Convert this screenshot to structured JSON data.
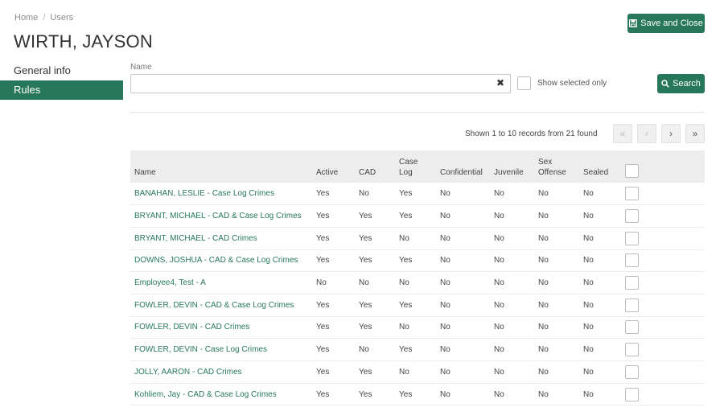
{
  "breadcrumb": {
    "home": "Home",
    "separator": "/",
    "current": "Users"
  },
  "page_title": "WIRTH, JAYSON",
  "actions": {
    "save_close": "Save and Close",
    "search": "Search"
  },
  "sidebar": {
    "items": [
      {
        "label": "General info",
        "active": false
      },
      {
        "label": "Rules",
        "active": true
      }
    ]
  },
  "filter": {
    "name_label": "Name",
    "name_value": "",
    "clear_glyph": "✖",
    "show_selected_label": "Show selected only"
  },
  "pager": {
    "info": "Shown 1 to 10 records from 21 found",
    "first": "«",
    "prev": "‹",
    "next": "›",
    "last": "»"
  },
  "table": {
    "headers": {
      "name": "Name",
      "active": "Active",
      "cad": "CAD",
      "case_log_1": "Case",
      "case_log_2": "Log",
      "confidential": "Confidential",
      "juvenile": "Juvenile",
      "sex_offense_1": "Sex",
      "sex_offense_2": "Offense",
      "sealed": "Sealed"
    },
    "rows": [
      {
        "name": "BANAHAN, LESLIE - Case Log Crimes",
        "active": "Yes",
        "cad": "No",
        "case_log": "Yes",
        "confidential": "No",
        "juvenile": "No",
        "sex_offense": "No",
        "sealed": "No"
      },
      {
        "name": "BRYANT, MICHAEL - CAD & Case Log Crimes",
        "active": "Yes",
        "cad": "Yes",
        "case_log": "Yes",
        "confidential": "No",
        "juvenile": "No",
        "sex_offense": "No",
        "sealed": "No"
      },
      {
        "name": "BRYANT, MICHAEL - CAD Crimes",
        "active": "Yes",
        "cad": "Yes",
        "case_log": "No",
        "confidential": "No",
        "juvenile": "No",
        "sex_offense": "No",
        "sealed": "No"
      },
      {
        "name": "DOWNS, JOSHUA - CAD & Case Log Crimes",
        "active": "Yes",
        "cad": "Yes",
        "case_log": "Yes",
        "confidential": "No",
        "juvenile": "No",
        "sex_offense": "No",
        "sealed": "No"
      },
      {
        "name": "Employee4, Test - A",
        "active": "No",
        "cad": "No",
        "case_log": "No",
        "confidential": "No",
        "juvenile": "No",
        "sex_offense": "No",
        "sealed": "No"
      },
      {
        "name": "FOWLER, DEVIN - CAD & Case Log Crimes",
        "active": "Yes",
        "cad": "Yes",
        "case_log": "Yes",
        "confidential": "No",
        "juvenile": "No",
        "sex_offense": "No",
        "sealed": "No"
      },
      {
        "name": "FOWLER, DEVIN - CAD Crimes",
        "active": "Yes",
        "cad": "Yes",
        "case_log": "No",
        "confidential": "No",
        "juvenile": "No",
        "sex_offense": "No",
        "sealed": "No"
      },
      {
        "name": "FOWLER, DEVIN - Case Log Crimes",
        "active": "Yes",
        "cad": "No",
        "case_log": "Yes",
        "confidential": "No",
        "juvenile": "No",
        "sex_offense": "No",
        "sealed": "No"
      },
      {
        "name": "JOLLY, AARON - CAD Crimes",
        "active": "Yes",
        "cad": "Yes",
        "case_log": "No",
        "confidential": "No",
        "juvenile": "No",
        "sex_offense": "No",
        "sealed": "No"
      },
      {
        "name": "Kohliem, Jay - CAD & Case Log Crimes",
        "active": "Yes",
        "cad": "Yes",
        "case_log": "Yes",
        "confidential": "No",
        "juvenile": "No",
        "sex_offense": "No",
        "sealed": "No"
      }
    ]
  },
  "colors": {
    "accent": "#27785a",
    "header_bg": "#ededed"
  }
}
